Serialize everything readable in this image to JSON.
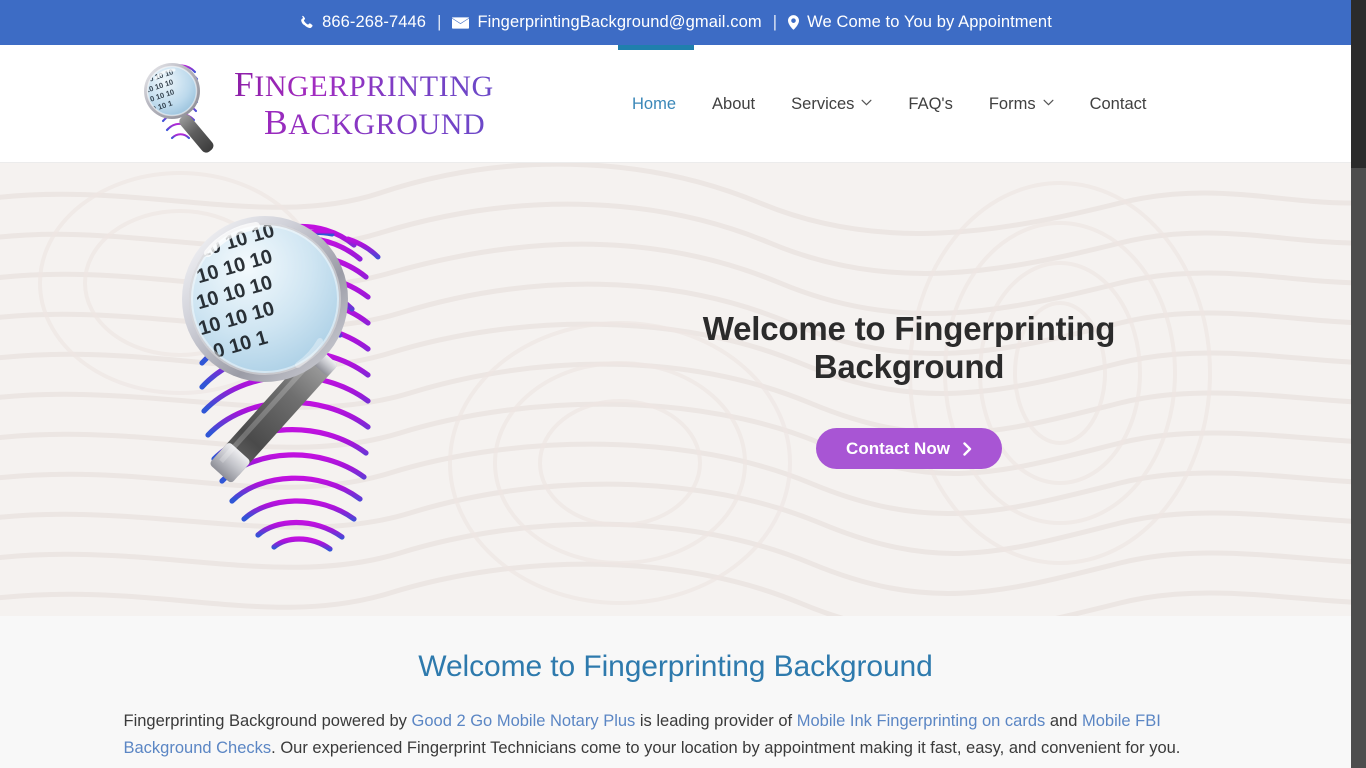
{
  "topbar": {
    "phone": "866-268-7446",
    "email": "FingerprintingBackground@gmail.com",
    "tagline": "We Come to You by Appointment",
    "separator": "|",
    "phone_icon": "phone-icon",
    "email_icon": "envelope-icon",
    "location_icon": "map-pin-icon",
    "background_color": "#3d6cc5"
  },
  "logo": {
    "line1": "Fingerprinting",
    "line2": "Background",
    "mark": "fingerprint-magnifier-logo-icon"
  },
  "nav": {
    "items": [
      {
        "label": "Home",
        "active": true,
        "has_dropdown": false
      },
      {
        "label": "About",
        "active": false,
        "has_dropdown": false
      },
      {
        "label": "Services",
        "active": false,
        "has_dropdown": true
      },
      {
        "label": "FAQ's",
        "active": false,
        "has_dropdown": false
      },
      {
        "label": "Forms",
        "active": false,
        "has_dropdown": true
      },
      {
        "label": "Contact",
        "active": false,
        "has_dropdown": false
      }
    ],
    "active_color": "#3a87b8",
    "indicator_color": "#1f7fad"
  },
  "hero": {
    "title": "Welcome to Fingerprinting Background",
    "cta_label": "Contact Now",
    "cta_icon": "chevron-right-icon",
    "cta_color": "#a855d4",
    "image": "fingerprint-with-magnifying-glass-illustration",
    "background_color": "#f5f2f0"
  },
  "intro": {
    "title": "Welcome to Fingerprinting Background",
    "title_color": "#2e7aad",
    "paragraph": {
      "seg1": "Fingerprinting Background powered by ",
      "link1": "Good 2 Go Mobile Notary Plus",
      "seg2": " is leading provider of ",
      "link2": "Mobile Ink Fingerprinting on  cards",
      "seg3": " and ",
      "link3": "Mobile FBI Background Checks",
      "seg4": ". Our experienced Fingerprint Technicians come to your location by appointment making it fast, easy, and convenient for you."
    },
    "link_color": "#5b86c4"
  },
  "scrollbar": {
    "position": "right",
    "thumb_at": "top"
  }
}
